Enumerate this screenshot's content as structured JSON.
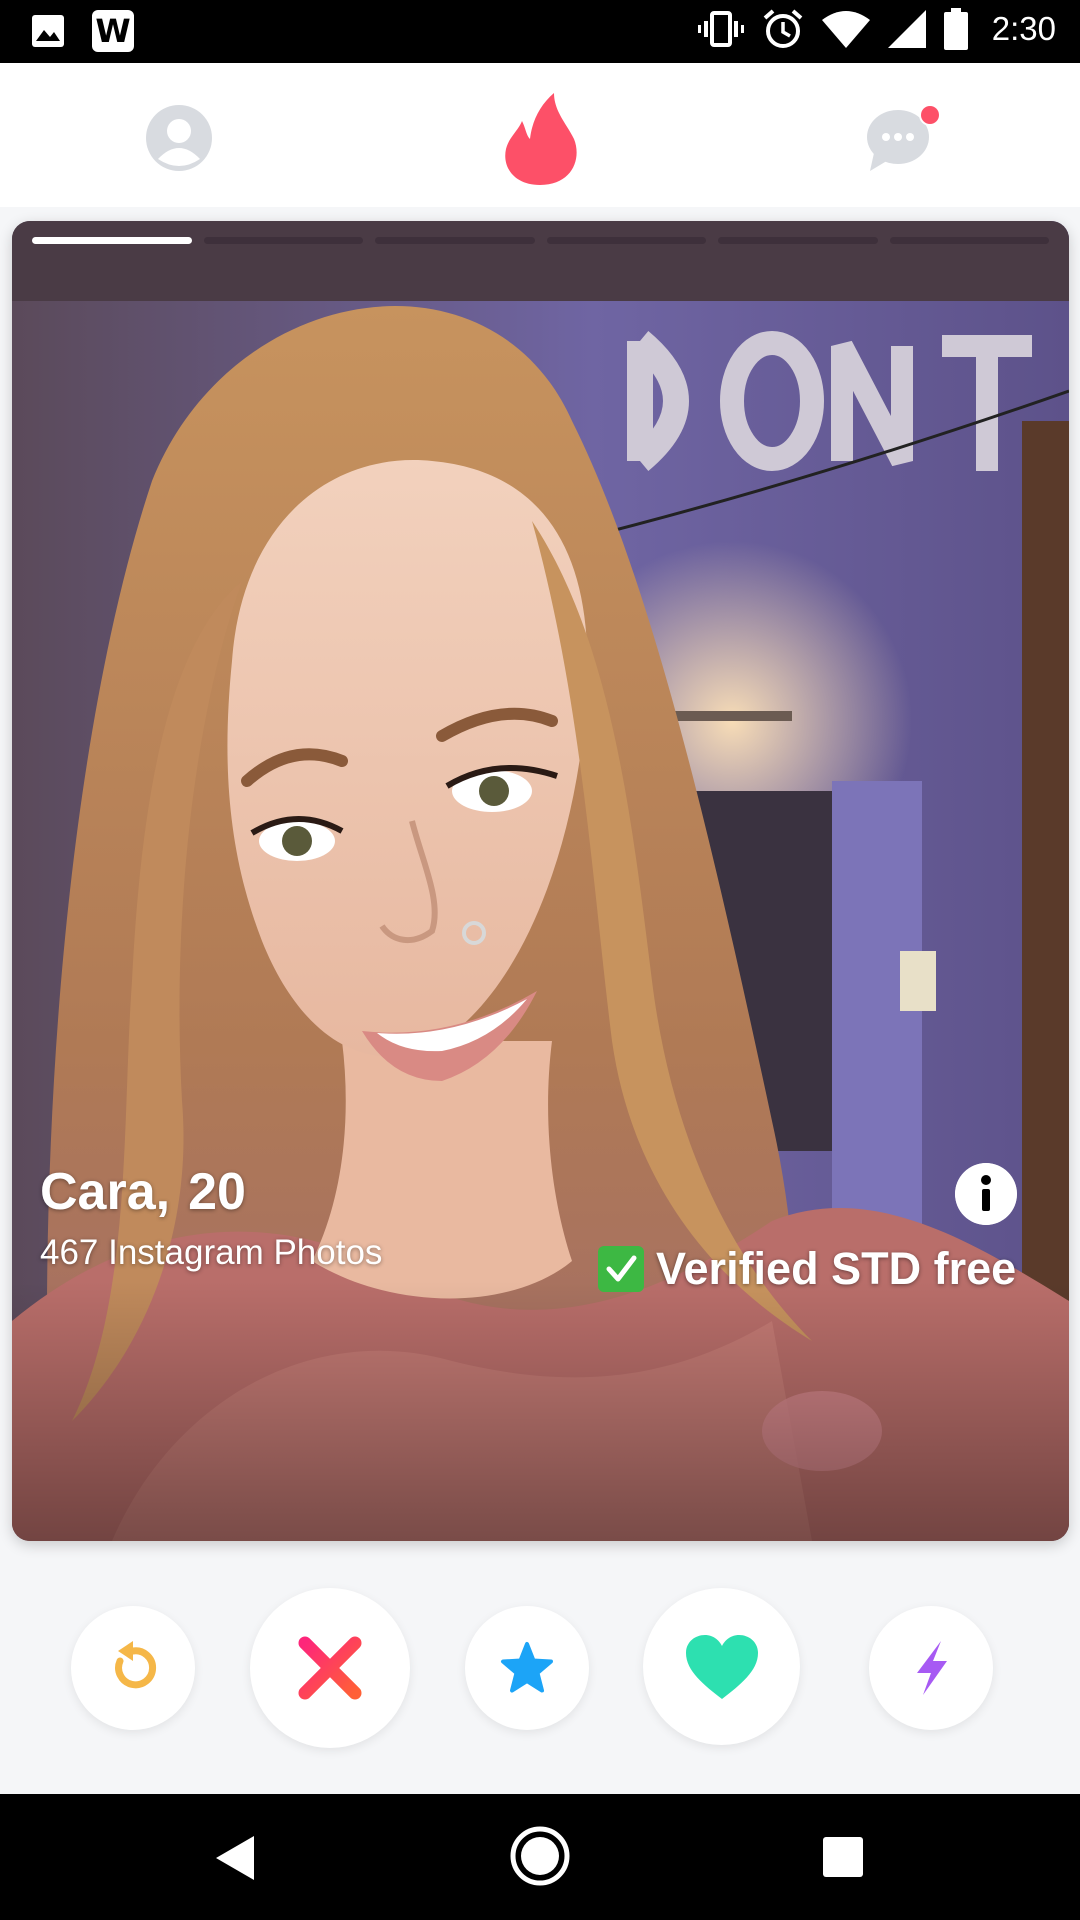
{
  "status_bar": {
    "time": "2:30",
    "left_icons": [
      "image-icon",
      "w-app-icon"
    ],
    "w_badge": "W",
    "right_icons": [
      "vibrate-icon",
      "alarm-icon",
      "wifi-icon",
      "signal-icon",
      "battery-icon"
    ]
  },
  "top_nav": {
    "items": [
      "profile-icon",
      "flame-icon",
      "chat-icon"
    ],
    "active": "flame-icon",
    "chat_has_notification": true
  },
  "card": {
    "name": "Cara,",
    "age": "20",
    "subtitle": "467 Instagram Photos",
    "verified_text": "Verified STD free",
    "photo_index": 1,
    "photo_count": 6
  },
  "actions": [
    {
      "name": "rewind-button",
      "icon": "rewind-icon",
      "color": "#f5b748"
    },
    {
      "name": "nope-button",
      "icon": "x-icon",
      "color": "#fd5068"
    },
    {
      "name": "super-like-button",
      "icon": "star-icon",
      "color": "#1ca4f7"
    },
    {
      "name": "like-button",
      "icon": "heart-icon",
      "color": "#2de0b0"
    },
    {
      "name": "boost-button",
      "icon": "bolt-icon",
      "color": "#a75af3"
    }
  ],
  "colors": {
    "brand": "#fd5068",
    "nav_inactive": "#d8dbe0",
    "verified_check": "#3db843"
  },
  "android_nav": [
    "back-icon",
    "home-icon",
    "recents-icon"
  ]
}
